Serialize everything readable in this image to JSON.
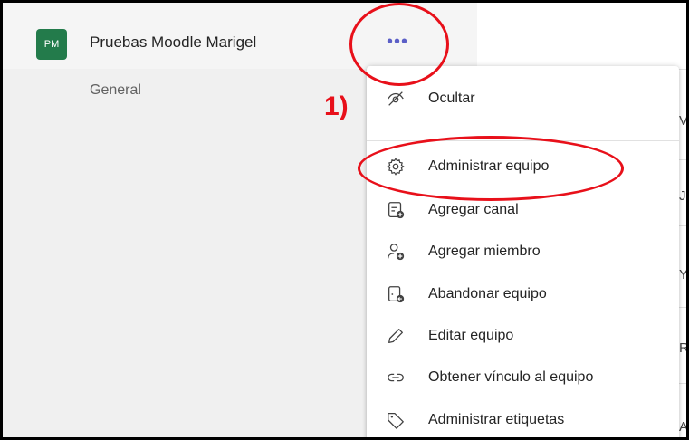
{
  "team": {
    "initials": "PM",
    "name": "Pruebas Moodle Marigel",
    "more_label": "•••",
    "channels": [
      "General"
    ]
  },
  "menu": {
    "items": [
      {
        "label": "Ocultar",
        "icon": "eye-off-icon"
      },
      {
        "label": "Administrar equipo",
        "icon": "gear-icon"
      },
      {
        "label": "Agregar canal",
        "icon": "add-channel-icon"
      },
      {
        "label": "Agregar miembro",
        "icon": "add-member-icon"
      },
      {
        "label": "Abandonar equipo",
        "icon": "leave-team-icon"
      },
      {
        "label": "Editar equipo",
        "icon": "pencil-icon"
      },
      {
        "label": "Obtener vínculo al equipo",
        "icon": "link-icon"
      },
      {
        "label": "Administrar etiquetas",
        "icon": "tag-icon"
      }
    ]
  },
  "main_letters": [
    "V",
    "J",
    "Y",
    "R",
    "A"
  ],
  "annotation": {
    "step": "1)",
    "color": "#e8101a"
  },
  "colors": {
    "avatar": "#237b4b",
    "more_button": "#5b5fc7"
  }
}
